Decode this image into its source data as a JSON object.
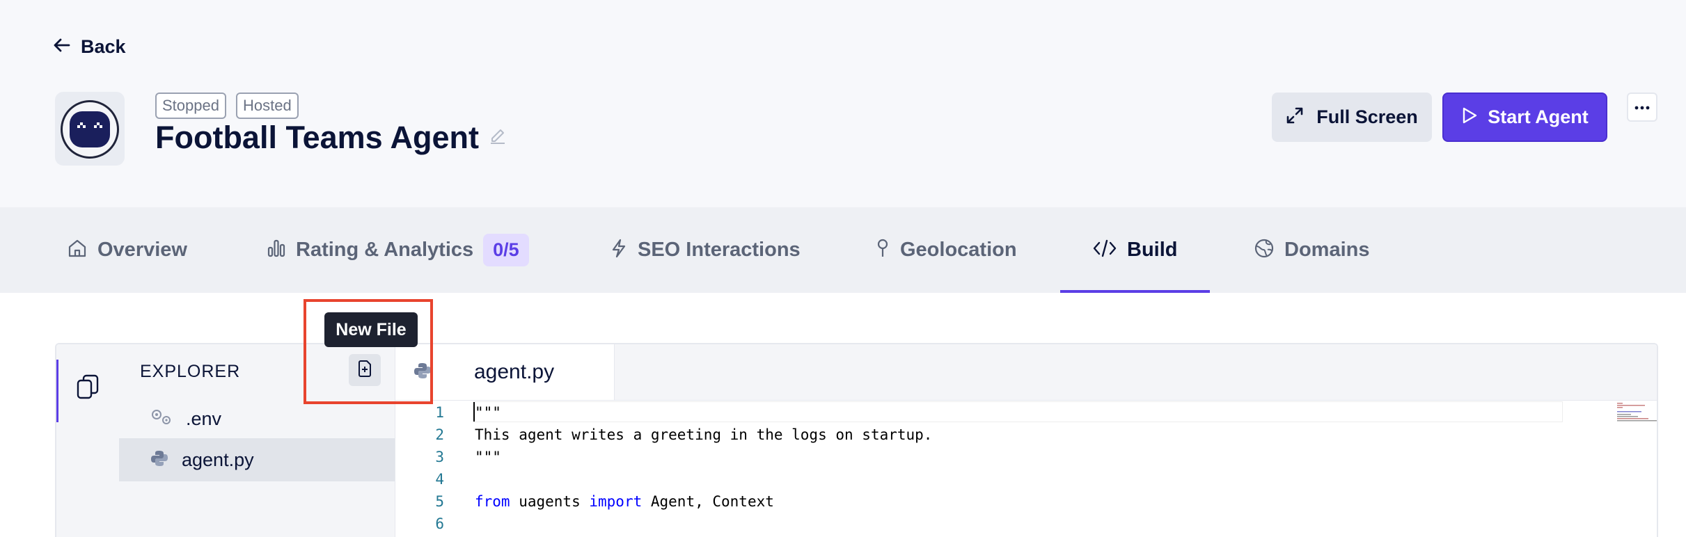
{
  "nav": {
    "back_label": "Back"
  },
  "agent": {
    "status_badge": "Stopped",
    "hosting_badge": "Hosted",
    "name": "Football Teams Agent"
  },
  "actions": {
    "fullscreen_label": "Full Screen",
    "start_label": "Start Agent",
    "more_label": "…"
  },
  "tabs": [
    {
      "label": "Overview",
      "icon": "home-icon"
    },
    {
      "label": "Rating & Analytics",
      "icon": "bar-chart-icon",
      "count": "0/5"
    },
    {
      "label": "SEO Interactions",
      "icon": "bolt-icon"
    },
    {
      "label": "Geolocation",
      "icon": "map-pin-icon"
    },
    {
      "label": "Build",
      "icon": "code-icon",
      "active": true
    },
    {
      "label": "Domains",
      "icon": "globe-icon"
    }
  ],
  "explorer": {
    "title": "EXPLORER",
    "tooltip": "New File",
    "files": [
      {
        "name": ".env",
        "icon": "gear-file-icon"
      },
      {
        "name": "agent.py",
        "icon": "python-icon",
        "selected": true
      }
    ]
  },
  "editor": {
    "open_tab": "agent.py",
    "lines": [
      {
        "num": "1",
        "text": "\"\"\""
      },
      {
        "num": "2",
        "text": "This agent writes a greeting in the logs on startup."
      },
      {
        "num": "3",
        "text": "\"\"\""
      },
      {
        "num": "4",
        "text": ""
      },
      {
        "num": "5",
        "kw1": "from",
        "mid": " uagents ",
        "kw2": "import",
        "tail": " Agent, Context"
      },
      {
        "num": "6",
        "text": ""
      }
    ]
  },
  "colors": {
    "accent": "#5b3ee6",
    "highlight": "#e8442e",
    "string": "#a31515",
    "keyword": "#0000ff"
  }
}
